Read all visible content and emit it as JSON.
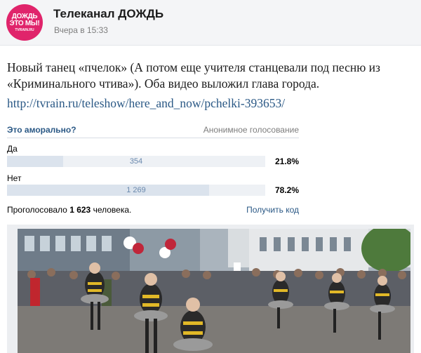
{
  "channel": {
    "avatar_text": [
      "ДОЖДЬ",
      "ЭТО МЫ!",
      "TVRAIN.RU"
    ],
    "name": "Телеканал ДОЖДЬ",
    "time": "Вчера в 15:33"
  },
  "post": {
    "text": "Новый танец «пчелок» (А потом еще учителя станцевали под песню из «Криминального чтива»). Оба видео выложил глава города.",
    "link": "http://tvrain.ru/teleshow/here_and_now/pchelki-393653/"
  },
  "poll": {
    "question": "Это аморально?",
    "type": "Анонимное голосование",
    "options": [
      {
        "label": "Да",
        "count": "354",
        "percent": "21.8%",
        "share": 0.218
      },
      {
        "label": "Нет",
        "count": "1 269",
        "percent": "78.2%",
        "share": 0.782
      }
    ],
    "total_prefix": "Проголосовало",
    "total_count": "1 623",
    "total_suffix": "человека.",
    "get_code": "Получить код"
  },
  "colors": {
    "brand": "#e0246b",
    "link": "#2a5885",
    "poll_bar": "#eef1f5",
    "poll_fill": "#dbe3ed"
  }
}
